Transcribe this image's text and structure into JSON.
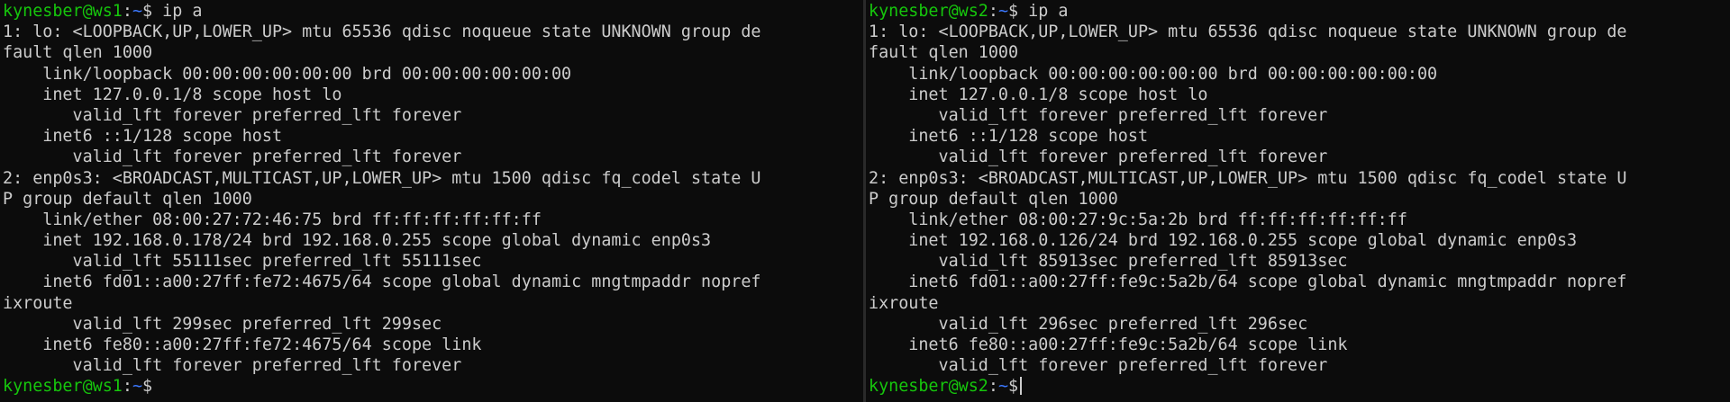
{
  "colors": {
    "background": "#0c0c0c",
    "foreground": "#cccccc",
    "prompt_user": "#16c60c",
    "prompt_path": "#3b78ff",
    "divider": "#2a2a2a"
  },
  "panes": [
    {
      "prompt_user": "kynesber@ws1",
      "prompt_sep": ":",
      "prompt_path": "~",
      "prompt_sign": "$",
      "command": " ip a",
      "lines": [
        "1: lo: <LOOPBACK,UP,LOWER_UP> mtu 65536 qdisc noqueue state UNKNOWN group de",
        "fault qlen 1000",
        "    link/loopback 00:00:00:00:00:00 brd 00:00:00:00:00:00",
        "    inet 127.0.0.1/8 scope host lo",
        "       valid_lft forever preferred_lft forever",
        "    inet6 ::1/128 scope host",
        "       valid_lft forever preferred_lft forever",
        "2: enp0s3: <BROADCAST,MULTICAST,UP,LOWER_UP> mtu 1500 qdisc fq_codel state U",
        "P group default qlen 1000",
        "    link/ether 08:00:27:72:46:75 brd ff:ff:ff:ff:ff:ff",
        "    inet 192.168.0.178/24 brd 192.168.0.255 scope global dynamic enp0s3",
        "       valid_lft 55111sec preferred_lft 55111sec",
        "    inet6 fd01::a00:27ff:fe72:4675/64 scope global dynamic mngtmpaddr nopref",
        "ixroute",
        "       valid_lft 299sec preferred_lft 299sec",
        "    inet6 fe80::a00:27ff:fe72:4675/64 scope link",
        "       valid_lft forever preferred_lft forever"
      ],
      "final_prompt_user": "kynesber@ws1",
      "final_prompt_sep": ":",
      "final_prompt_path": "~",
      "final_prompt_sign": "$"
    },
    {
      "prompt_user": "kynesber@ws2",
      "prompt_sep": ":",
      "prompt_path": "~",
      "prompt_sign": "$",
      "command": " ip a",
      "lines": [
        "1: lo: <LOOPBACK,UP,LOWER_UP> mtu 65536 qdisc noqueue state UNKNOWN group de",
        "fault qlen 1000",
        "    link/loopback 00:00:00:00:00:00 brd 00:00:00:00:00:00",
        "    inet 127.0.0.1/8 scope host lo",
        "       valid_lft forever preferred_lft forever",
        "    inet6 ::1/128 scope host",
        "       valid_lft forever preferred_lft forever",
        "2: enp0s3: <BROADCAST,MULTICAST,UP,LOWER_UP> mtu 1500 qdisc fq_codel state U",
        "P group default qlen 1000",
        "    link/ether 08:00:27:9c:5a:2b brd ff:ff:ff:ff:ff:ff",
        "    inet 192.168.0.126/24 brd 192.168.0.255 scope global dynamic enp0s3",
        "       valid_lft 85913sec preferred_lft 85913sec",
        "    inet6 fd01::a00:27ff:fe9c:5a2b/64 scope global dynamic mngtmpaddr nopref",
        "ixroute",
        "       valid_lft 296sec preferred_lft 296sec",
        "    inet6 fe80::a00:27ff:fe9c:5a2b/64 scope link",
        "       valid_lft forever preferred_lft forever"
      ],
      "final_prompt_user": "kynesber@ws2",
      "final_prompt_sep": ":",
      "final_prompt_path": "~",
      "final_prompt_sign": "$"
    }
  ]
}
